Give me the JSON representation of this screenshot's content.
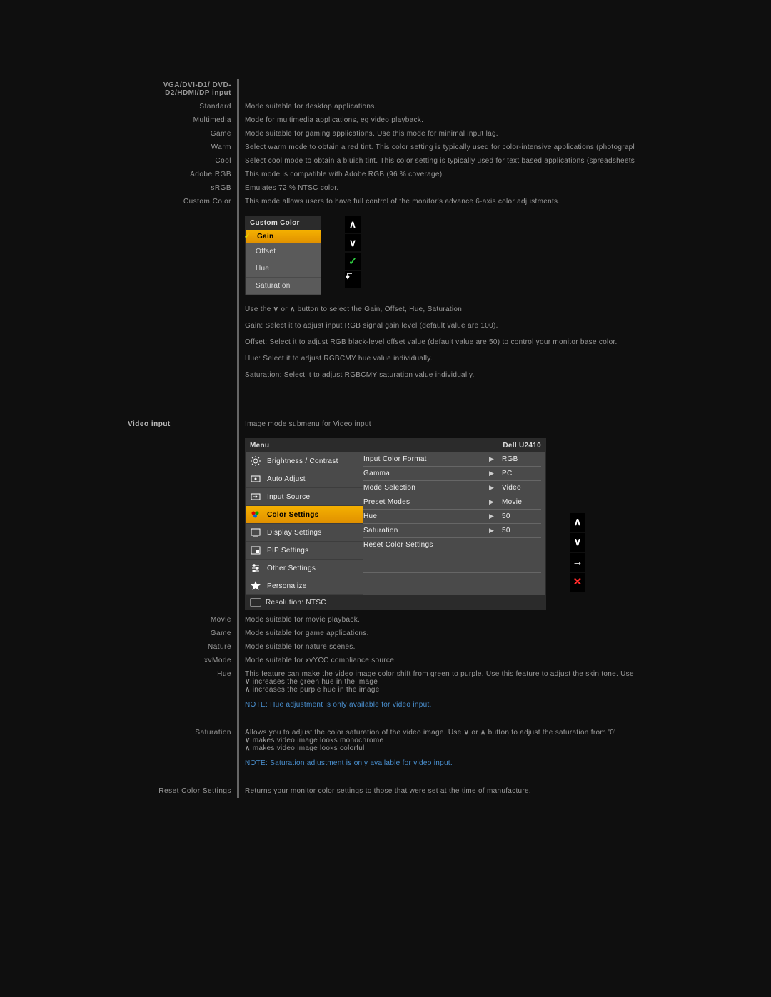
{
  "section1_header": "VGA/DVI-D1/ DVD-D2/HDMI/DP input",
  "rows1": [
    {
      "l": "Standard",
      "d": "Mode suitable for desktop applications."
    },
    {
      "l": "Multimedia",
      "d": "Mode for multimedia applications, eg video playback."
    },
    {
      "l": "Game",
      "d": "Mode suitable for gaming applications. Use this mode for minimal input lag."
    },
    {
      "l": "Warm",
      "d": "Select warm mode to obtain a red tint. This color setting is typically used for color-intensive applications (photograpl"
    },
    {
      "l": "Cool",
      "d": "Select cool mode to obtain a bluish tint. This color setting is typically used for text based applications (spreadsheets"
    },
    {
      "l": "Adobe RGB",
      "d": "This mode is compatible with Adobe RGB (96 % coverage)."
    },
    {
      "l": "sRGB",
      "d": "Emulates 72 % NTSC color."
    },
    {
      "l": "Custom Color",
      "d": "This mode allows users to have full control of the monitor's advance 6-axis color adjustments."
    }
  ],
  "osd1": {
    "title": "Custom Color",
    "selected": "Gain",
    "items": [
      "Offset",
      "Hue",
      "Saturation"
    ]
  },
  "p_use": "button to select the Gain, Offset, Hue, Saturation.",
  "p_use_pre": "Use the ",
  "p_use_mid": " or ",
  "p_gain": "Gain: Select it to adjust input RGB signal gain level (default value are 100).",
  "p_offset": "Offset: Select it to adjust RGB black-level offset value (default value are 50) to control your monitor base color.",
  "p_hue": "Hue: Select it to adjust RGBCMY hue value individually.",
  "p_sat": "Saturation: Select it to adjust RGBCMY saturation value individually.",
  "section2_header": "Video input",
  "section2_intro": "Image mode submenu for Video input",
  "osd2": {
    "menu": "Menu",
    "model": "Dell  U2410",
    "left": [
      {
        "icon": "brightness",
        "label": "Brightness / Contrast"
      },
      {
        "icon": "auto",
        "label": "Auto Adjust"
      },
      {
        "icon": "input",
        "label": "Input Source"
      },
      {
        "icon": "color",
        "label": "Color Settings"
      },
      {
        "icon": "display",
        "label": "Display Settings"
      },
      {
        "icon": "pip",
        "label": "PIP Settings"
      },
      {
        "icon": "other",
        "label": "Other Settings"
      },
      {
        "icon": "star",
        "label": "Personalize"
      }
    ],
    "right": [
      {
        "label": "Input Color Format",
        "val": "RGB",
        "arr": true
      },
      {
        "label": "Gamma",
        "val": "PC",
        "arr": true
      },
      {
        "label": "Mode Selection",
        "val": "Video",
        "arr": true
      },
      {
        "label": "Preset Modes",
        "val": "Movie",
        "arr": true
      },
      {
        "label": "Hue",
        "val": "50",
        "arr": true
      },
      {
        "label": "Saturation",
        "val": "50",
        "arr": true
      },
      {
        "label": "Reset Color Settings",
        "val": "",
        "arr": false
      }
    ],
    "footer": "Resolution: NTSC"
  },
  "rows2": [
    {
      "l": "Movie",
      "d": "Mode suitable for movie playback."
    },
    {
      "l": "Game",
      "d": "Mode suitable for game applications."
    },
    {
      "l": "Nature",
      "d": "Mode suitable for nature scenes."
    },
    {
      "l": "xvMode",
      "d": "Mode suitable for xvYCC compliance source."
    }
  ],
  "hue_label": "Hue",
  "hue_d1": "This feature can make the video image color shift from green to purple. Use this feature to adjust the skin tone. Use",
  "hue_d2": " increases the green hue in the image",
  "hue_d3": " increases the purple hue in the image",
  "hue_note": "NOTE: Hue adjustment is only available for video input.",
  "sat_label": "Saturation",
  "sat_d1a": "Allows you to adjust the color saturation of the video image. Use ",
  "sat_d1b": " or ",
  "sat_d1c": " button to adjust the saturation from '0' ",
  "sat_d2": " makes video image looks monochrome",
  "sat_d3": " makes video image looks colorful",
  "sat_note": "NOTE: Saturation adjustment is only available for video input.",
  "reset_label": "Reset Color Settings",
  "reset_d": "Returns your monitor color settings to those that were set at the time of manufacture."
}
